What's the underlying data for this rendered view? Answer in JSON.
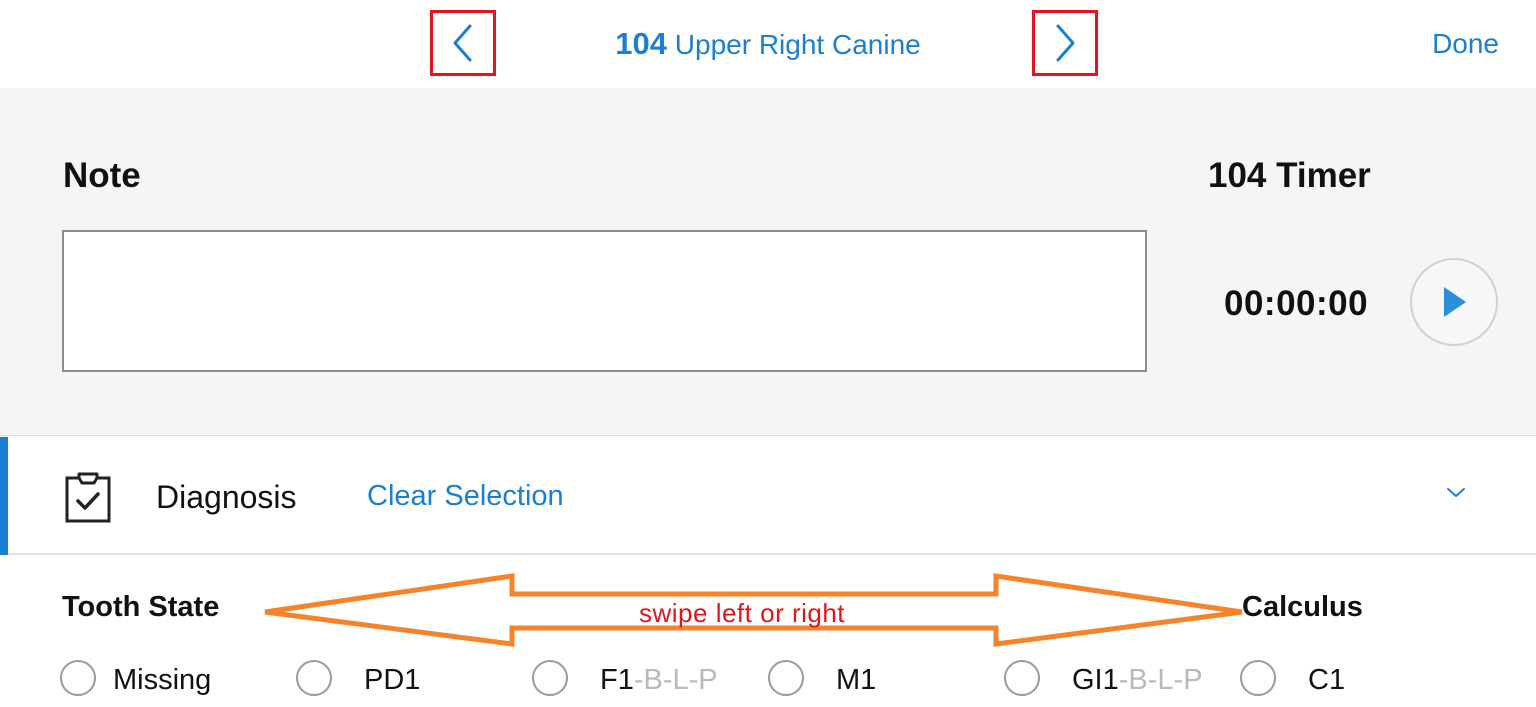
{
  "navbar": {
    "tooth_number": "104",
    "tooth_name": "Upper Right Canine",
    "done_label": "Done",
    "prev_icon": "chevron-left-icon",
    "next_icon": "chevron-right-icon"
  },
  "note": {
    "label": "Note",
    "value": ""
  },
  "timer": {
    "label": "104 Timer",
    "value": "00:00:00",
    "play_icon": "play-icon"
  },
  "diagnosis": {
    "label": "Diagnosis",
    "clear_label": "Clear Selection",
    "icon": "clipboard-check-icon",
    "expand_icon": "chevron-down-icon"
  },
  "annotation": {
    "text": "swipe left or right"
  },
  "groups": {
    "tooth_state": "Tooth State",
    "calculus": "Calculus"
  },
  "options": [
    {
      "label": "Missing",
      "suffix": "",
      "selected": false
    },
    {
      "label": "PD1",
      "suffix": "",
      "selected": false
    },
    {
      "label": "F1",
      "suffix": "-B-L-P",
      "selected": false
    },
    {
      "label": "M1",
      "suffix": "",
      "selected": false
    },
    {
      "label": "GI1",
      "suffix": "-B-L-P",
      "selected": false
    },
    {
      "label": "C1",
      "suffix": "",
      "selected": false
    }
  ],
  "colors": {
    "accent": "#1a7fd4",
    "highlight_box": "#e2141d",
    "arrow": "#f5832a",
    "annotation_text": "#e2141d",
    "panel_bg": "#f5f5f5",
    "suffix_text": "#b9b9b9"
  }
}
